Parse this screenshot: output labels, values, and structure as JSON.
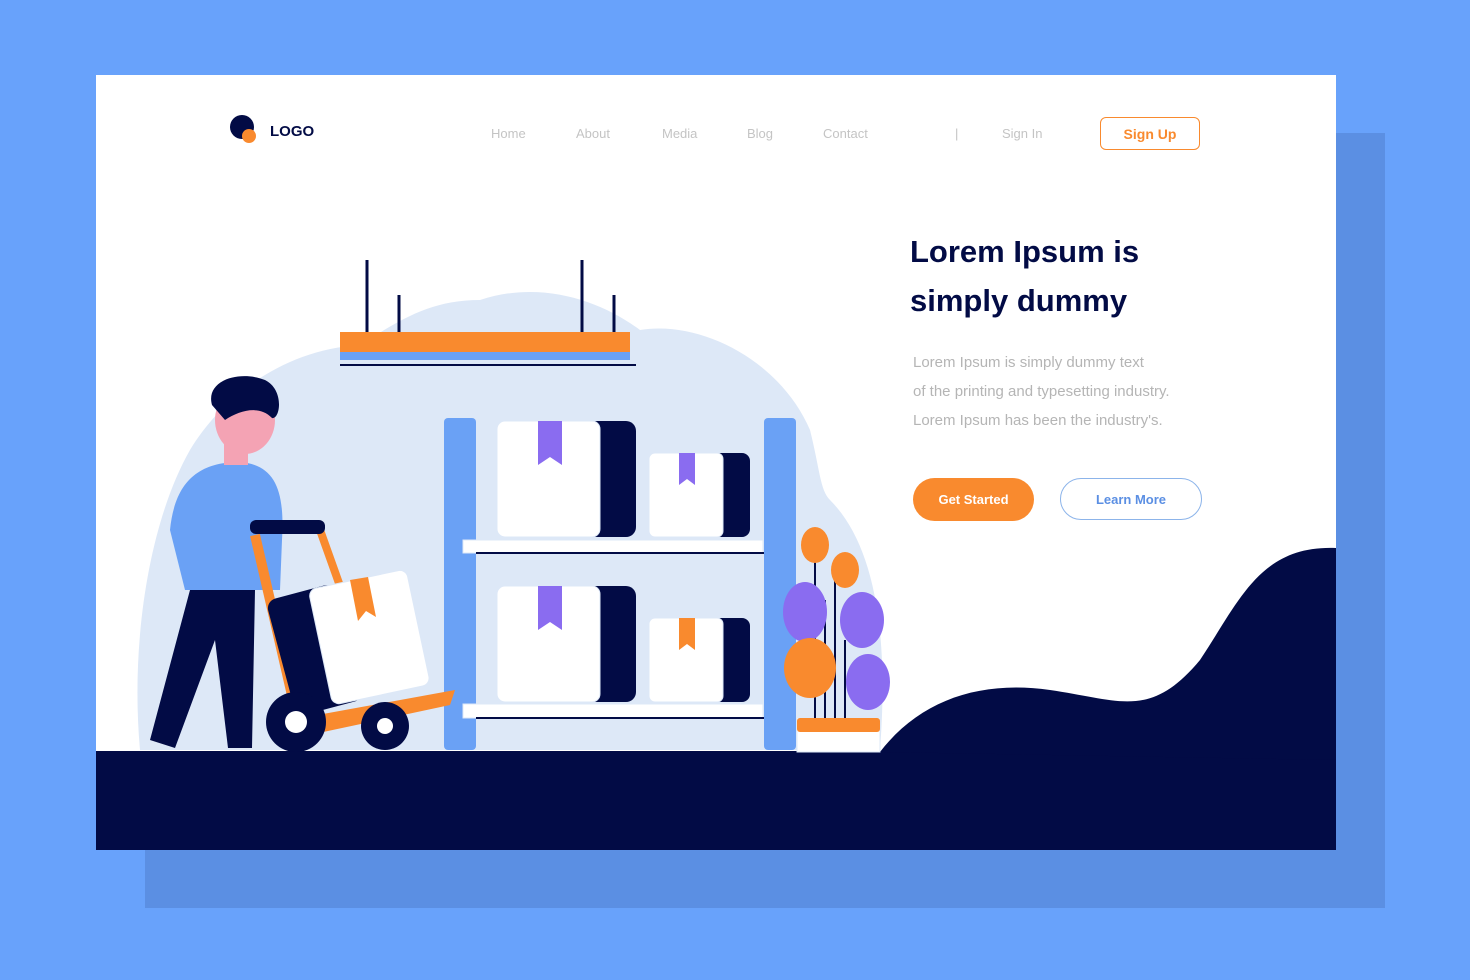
{
  "colors": {
    "background": "#68a2fb",
    "navy": "#020b45",
    "orange": "#f98a2e",
    "blue": "#6aa1f5",
    "purple": "#8a6cf0",
    "blob": "#dde8f7"
  },
  "header": {
    "logo": "LOGO",
    "nav": [
      "Home",
      "About",
      "Media",
      "Blog",
      "Contact"
    ],
    "separator": "|",
    "sign_in": "Sign In",
    "sign_up": "Sign Up"
  },
  "hero": {
    "title": "Lorem Ipsum is simply dummy",
    "description": [
      "Lorem Ipsum is simply dummy text",
      "of the printing and typesetting industry.",
      "Lorem Ipsum has been the industry's."
    ],
    "primary_button": "Get Started",
    "secondary_button": "Learn More"
  }
}
